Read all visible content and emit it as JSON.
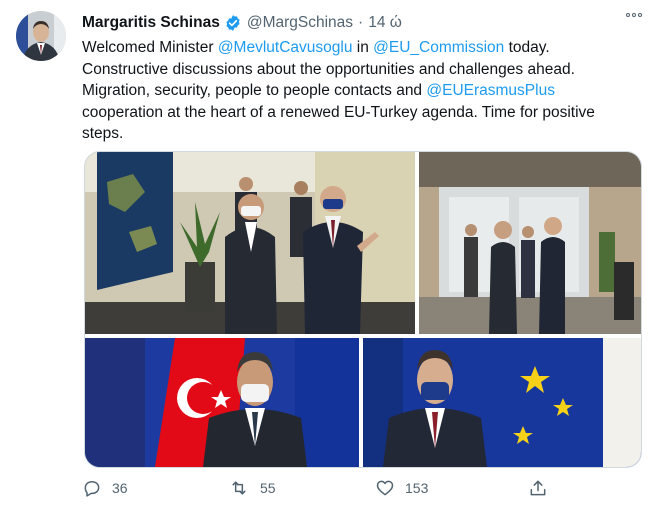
{
  "tweet": {
    "author_name": "Margaritis Schinas",
    "handle": "@MargSchinas",
    "separator": "·",
    "time": "14 ώ",
    "text": {
      "line1_a": "Welcomed Minister ",
      "mention1": "@MevlutCavusoglu",
      "line1_b": " in ",
      "mention2": "@EU_Commission",
      "line1_c": " today.",
      "line2": "Constructive discussions about the opportunities and challenges ahead.",
      "line3_a": "Migration, security, people to people contacts and ",
      "mention3": "@EUErasmusPlus",
      "line4": "cooperation at the heart of a renewed EU-Turkey agenda. Time for positive",
      "line5": "steps."
    }
  },
  "stats": {
    "replies": "36",
    "retweets": "55",
    "likes": "153"
  },
  "icons": {
    "verified": "verified-badge-icon",
    "more": "more-options-icon",
    "reply": "reply-icon",
    "retweet": "retweet-icon",
    "like": "heart-icon",
    "share": "share-icon"
  },
  "colors": {
    "link": "#1d9bf0",
    "secondary_text": "#536471",
    "eu_blue": "#1a3a8f",
    "turkey_red": "#e30a17"
  }
}
